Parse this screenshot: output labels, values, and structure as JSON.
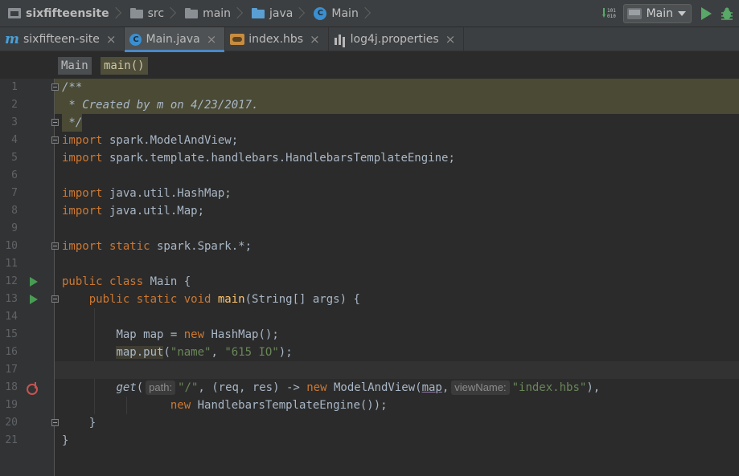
{
  "navbar": {
    "crumbs": [
      {
        "label": "sixfifteensite",
        "icon": "project-folder-icon"
      },
      {
        "label": "src",
        "icon": "folder-icon"
      },
      {
        "label": "main",
        "icon": "folder-icon"
      },
      {
        "label": "java",
        "icon": "source-folder-icon"
      },
      {
        "label": "Main",
        "icon": "class-icon"
      }
    ],
    "run_config": "Main"
  },
  "tabs": [
    {
      "label": "sixfifteen-site",
      "close": "×"
    },
    {
      "label": "Main.java",
      "close": "×"
    },
    {
      "label": "index.hbs",
      "close": "×"
    },
    {
      "label": "log4j.properties",
      "close": "×"
    }
  ],
  "tab_module_glyph": "m",
  "breadcrumb": {
    "class": "Main",
    "method": "main()"
  },
  "editor": {
    "line_numbers": [
      "1",
      "2",
      "3",
      "4",
      "5",
      "6",
      "7",
      "8",
      "9",
      "10",
      "11",
      "12",
      "13",
      "14",
      "15",
      "16",
      "17",
      "18",
      "19",
      "20",
      "21"
    ],
    "l1": "/**",
    "l2": " * Created by m on 4/23/2017.",
    "l3": " */",
    "l4_kw": "import",
    "l4_rest": " spark.ModelAndView;",
    "l5_kw": "import",
    "l5_rest": " spark.template.handlebars.HandlebarsTemplateEngine;",
    "l7_kw": "import",
    "l7_rest": " java.util.HashMap;",
    "l8_kw": "import",
    "l8_rest": " java.util.Map;",
    "l10_kw": "import static",
    "l10_rest": " spark.Spark.*;",
    "l12_kw": "public class",
    "l12_rest": " Main {",
    "l13_indent": "    ",
    "l13_kw": "public static void",
    "l13_fn": "main",
    "l13_rest": "(String[] args) {",
    "l15_indent": "        ",
    "l15_a": "Map map = ",
    "l15_kw": "new",
    "l15_b": " HashMap();",
    "l16_indent": "        ",
    "l16_a": "map.put",
    "l16_b": "(",
    "l16_s1": "\"name\"",
    "l16_c": ", ",
    "l16_s2": "\"615 IO\"",
    "l16_d": ");",
    "l18_indent": "        ",
    "l18_fn": "get",
    "l18_a": "(",
    "l18_hint1": "path:",
    "l18_s1": "\"/\"",
    "l18_b": ", (req, res) -> ",
    "l18_kw": "new",
    "l18_c": " ModelAndView(",
    "l18_var": "map",
    "l18_d": ",",
    "l18_hint2": "viewName:",
    "l18_s2": "\"index.hbs\"",
    "l18_e": "),",
    "l19_indent": "                ",
    "l19_kw": "new",
    "l19_rest": " HandlebarsTemplateEngine());",
    "l20_indent": "    ",
    "l20": "}",
    "l21": "}"
  }
}
